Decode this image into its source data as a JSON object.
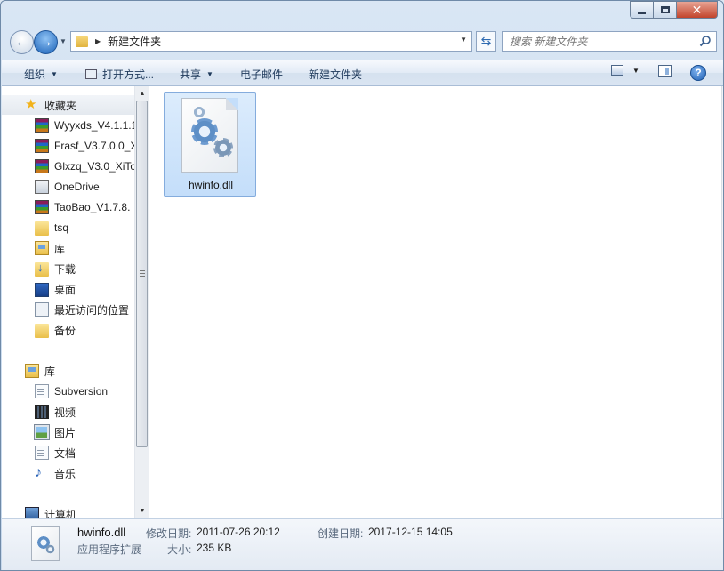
{
  "window": {
    "minimize_icon": "minimize-icon",
    "maximize_icon": "maximize-icon",
    "close_glyph": "✕"
  },
  "nav": {
    "back_glyph": "←",
    "forward_glyph": "→",
    "address_crumb": "新建文件夹",
    "search_placeholder": "搜索 新建文件夹"
  },
  "toolbar": {
    "organize": "组织",
    "open_with": "打开方式...",
    "share": "共享",
    "email": "电子邮件",
    "new_folder": "新建文件夹",
    "help": "?"
  },
  "sidebar": {
    "favorites_header": "收藏夹",
    "favorites": [
      {
        "label": "Wyyxds_V4.1.1.1",
        "icon": "rar-archive-icon"
      },
      {
        "label": "Frasf_V3.7.0.0_X",
        "icon": "rar-archive-icon"
      },
      {
        "label": "Glxzq_V3.0_XiTo",
        "icon": "rar-archive-icon"
      },
      {
        "label": "OneDrive",
        "icon": "onedrive-icon"
      },
      {
        "label": "TaoBao_V1.7.8.",
        "icon": "rar-archive-icon"
      },
      {
        "label": "tsq",
        "icon": "folder-icon"
      },
      {
        "label": "库",
        "icon": "library-icon"
      },
      {
        "label": "下载",
        "icon": "downloads-icon"
      },
      {
        "label": "桌面",
        "icon": "desktop-icon"
      },
      {
        "label": "最近访问的位置",
        "icon": "recent-places-icon"
      },
      {
        "label": "备份",
        "icon": "folder-icon"
      }
    ],
    "libraries_header": "库",
    "libraries": [
      {
        "label": "Subversion",
        "icon": "document-icon"
      },
      {
        "label": "视频",
        "icon": "video-icon"
      },
      {
        "label": "图片",
        "icon": "picture-icon"
      },
      {
        "label": "文档",
        "icon": "document-icon"
      },
      {
        "label": "音乐",
        "icon": "music-icon"
      }
    ],
    "computer_header": "计算机"
  },
  "files": [
    {
      "name": "hwinfo.dll",
      "icon": "dll-file-icon",
      "selected": true
    }
  ],
  "details": {
    "name": "hwinfo.dll",
    "type": "应用程序扩展",
    "modified_label": "修改日期:",
    "modified_value": "2011-07-26 20:12",
    "created_label": "创建日期:",
    "created_value": "2017-12-15 14:05",
    "size_label": "大小:",
    "size_value": "235 KB"
  }
}
